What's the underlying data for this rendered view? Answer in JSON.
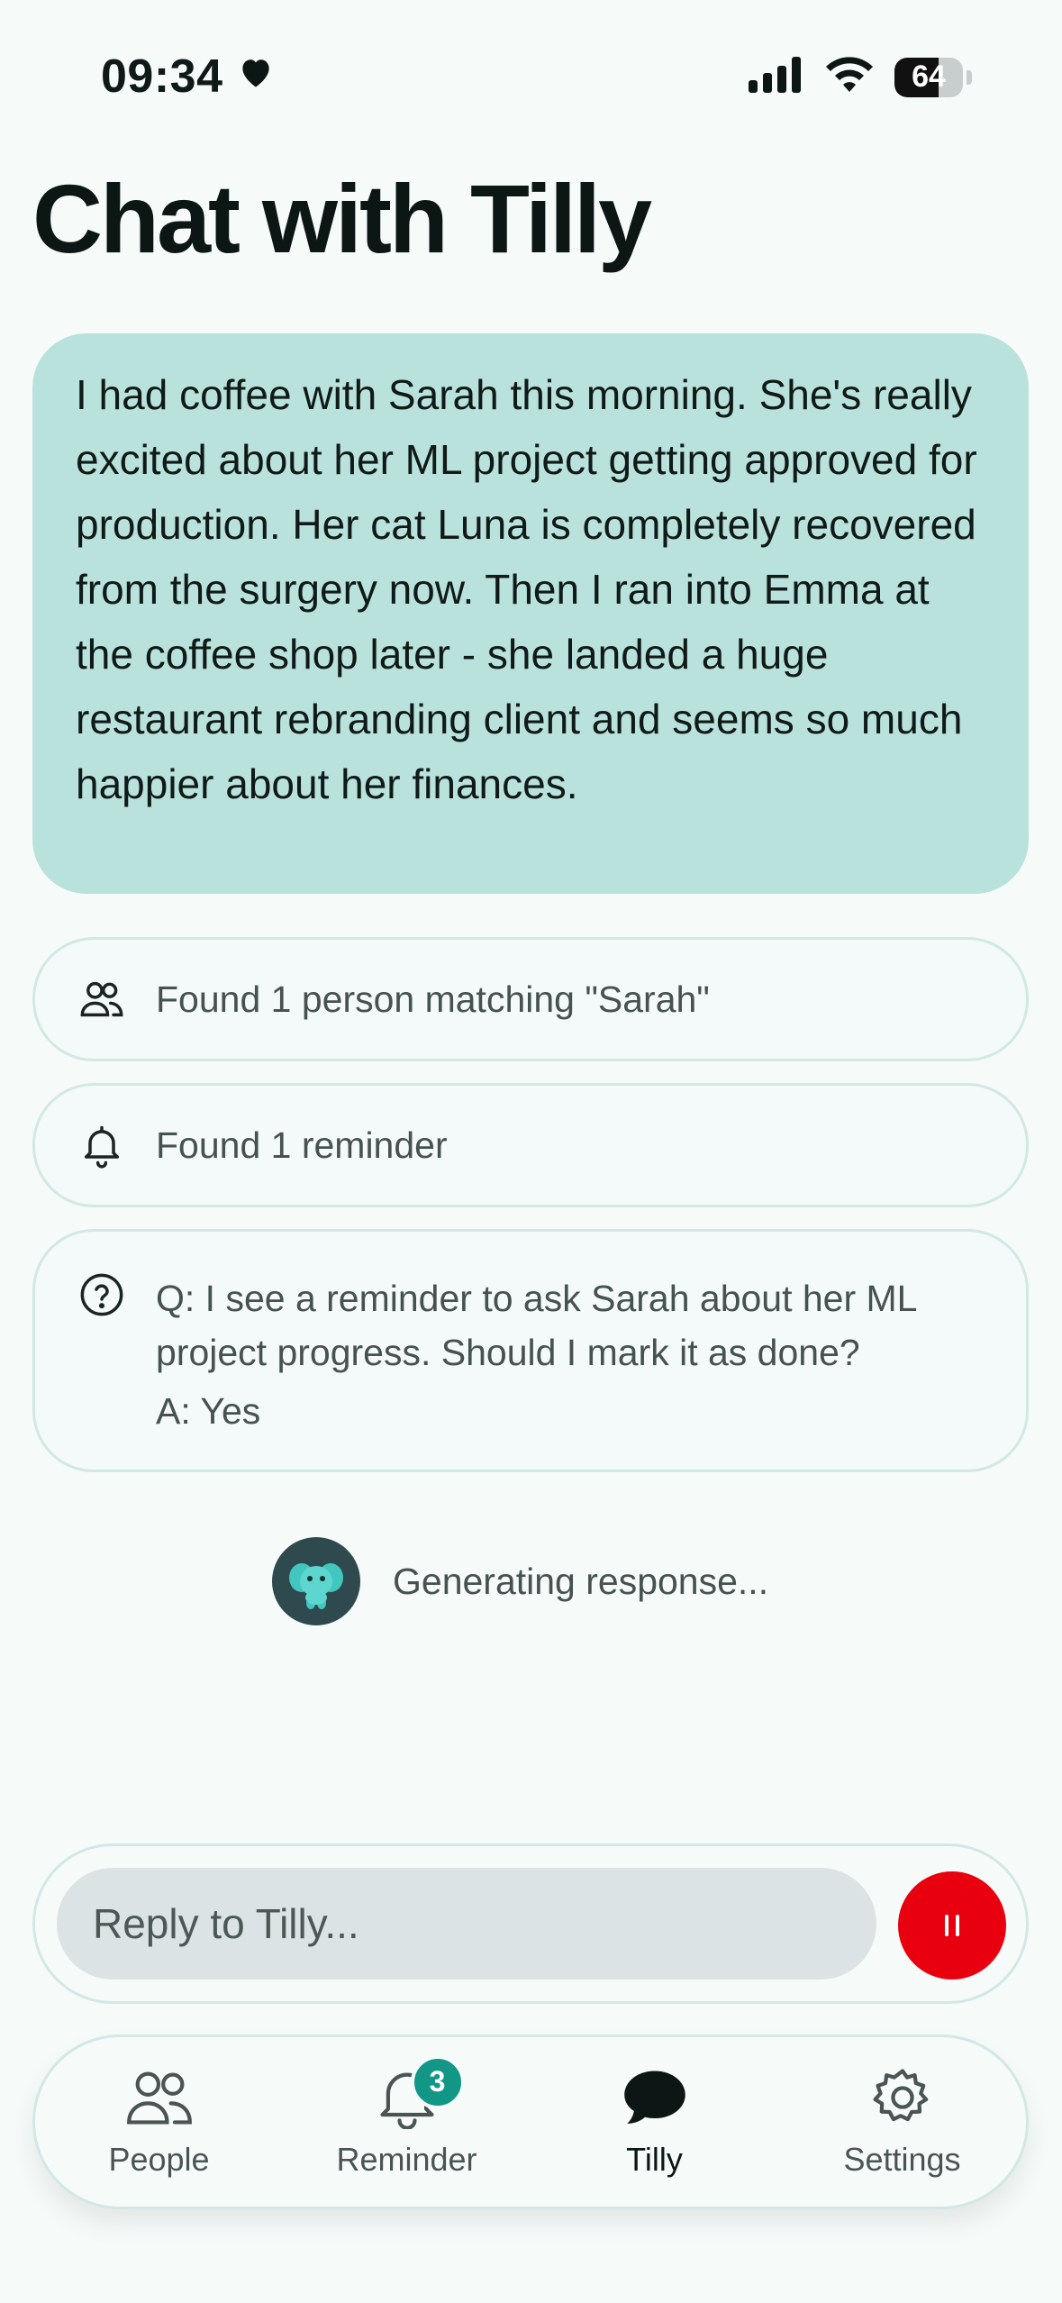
{
  "status_bar": {
    "time": "09:34",
    "battery": "64",
    "battery_level": 0.64
  },
  "title": "Chat with Tilly",
  "user_message": "I had coffee with Sarah this morning. She's really excited about her ML project getting approved for production. Her cat Luna is completely recovered from the surgery now. Then I ran into Emma at the coffee shop later - she landed a huge restaurant rebranding client and seems so much happier about her finances.",
  "tool_cards": {
    "people": {
      "icon": "people-icon",
      "text": "Found 1 person matching \"Sarah\""
    },
    "reminder": {
      "icon": "bell-icon",
      "text": "Found 1 reminder"
    },
    "question": {
      "icon": "question-icon",
      "question": "Q: I see a reminder to ask Sarah about her ML project progress. Should I mark it as done?",
      "answer": "A: Yes"
    }
  },
  "generating": {
    "avatar": "elephant-avatar",
    "text": "Generating response..."
  },
  "reply": {
    "placeholder": "Reply to Tilly...",
    "stop_color": "#e8000f"
  },
  "tabs": [
    {
      "label": "People",
      "icon": "people-icon",
      "active": false
    },
    {
      "label": "Reminder",
      "icon": "bell-icon",
      "active": false,
      "badge": "3"
    },
    {
      "label": "Tilly",
      "icon": "chat-bubble-icon",
      "active": true
    },
    {
      "label": "Settings",
      "icon": "gear-icon",
      "active": false
    }
  ],
  "colors": {
    "accent": "#129787",
    "user_bubble": "#bae2dc",
    "background": "#f6fbfa"
  }
}
